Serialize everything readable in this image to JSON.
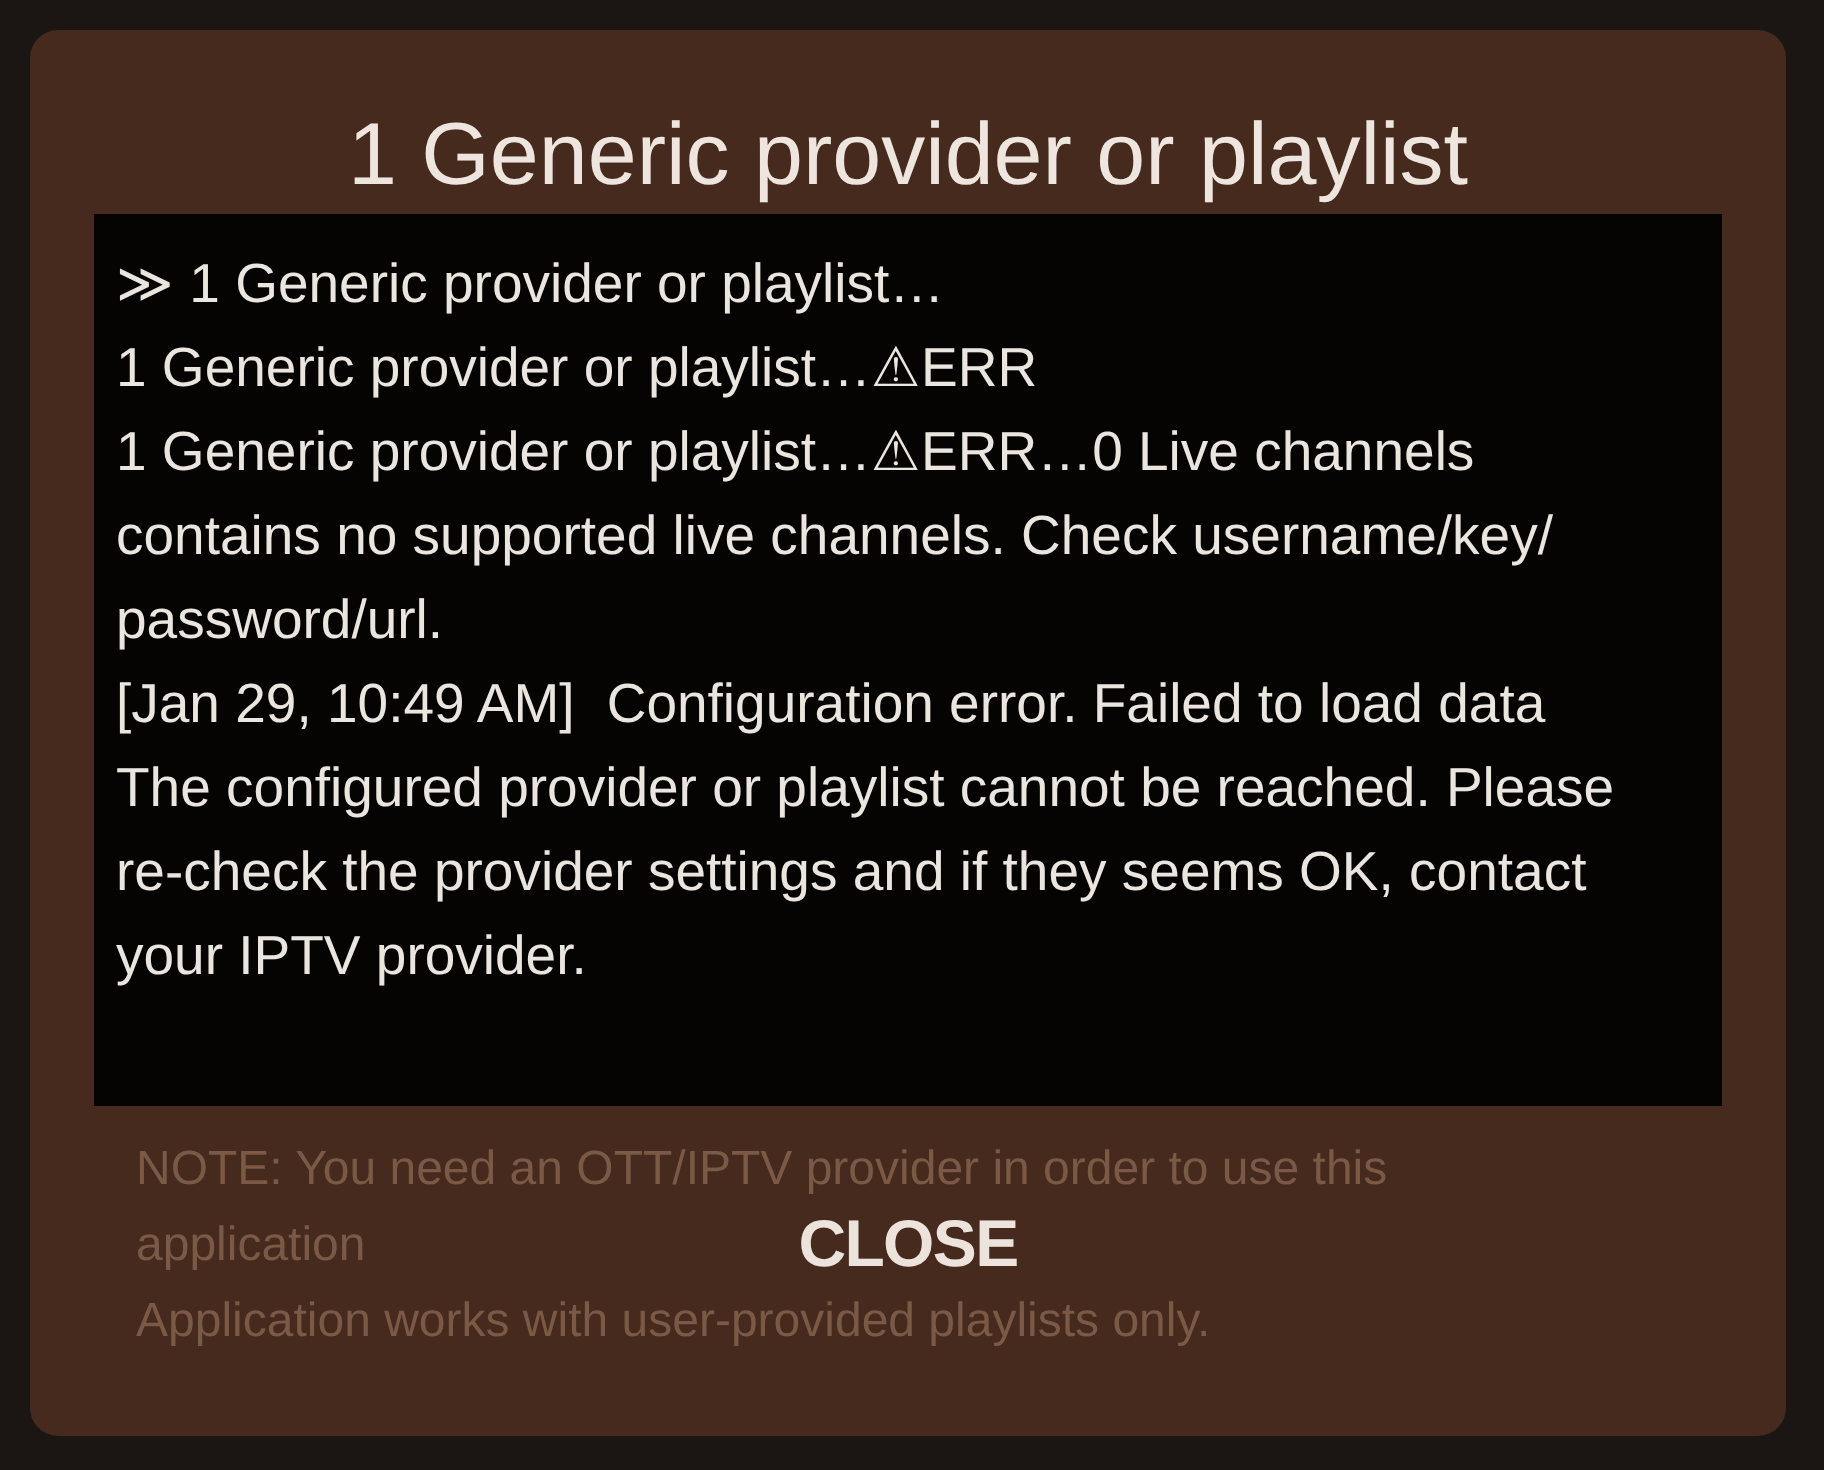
{
  "dialog": {
    "title": "1 Generic provider or playlist",
    "log": [
      {
        "text": "≫ 1 Generic provider or playlist…"
      },
      {
        "text": "1 Generic provider or playlist…⚠ERR"
      },
      {
        "text": "1 Generic provider or playlist…⚠ERR…0 Live channels contains no supported live channels. Check username/key/ password/url."
      },
      {
        "time": "[Jan 29, 10:49 AM]",
        "text": "Configuration error. Failed to load data"
      },
      {
        "text": "The configured provider or playlist cannot be reached. Please re-check the provider settings and if they seems OK, contact your IPTV provider."
      }
    ],
    "background_note": [
      "NOTE: You need an OTT/IPTV provider in order to use this",
      "application",
      "Application works with user-provided playlists only."
    ],
    "buttons": [
      "CLOSE"
    ]
  }
}
